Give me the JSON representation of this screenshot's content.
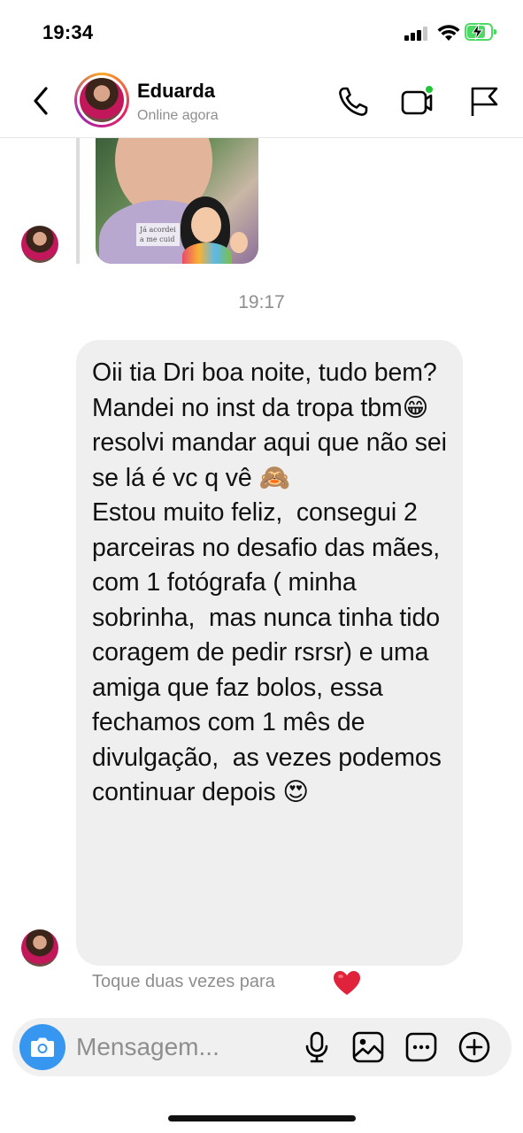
{
  "status_bar": {
    "time": "19:34"
  },
  "header": {
    "contact_name": "Eduarda",
    "contact_status": "Online agora",
    "icons": [
      "back-chevron-icon",
      "phone-icon",
      "video-camera-icon",
      "flag-icon"
    ]
  },
  "story_reply": {
    "caption": "Já acordei\na me cuid"
  },
  "timestamp": "19:17",
  "message": {
    "text": "Oii tia Dri boa noite, tudo bem?\nMandei no inst da tropa tbm😁 resolvi mandar aqui que não sei se lá é vc q vê 🙈\nEstou muito feliz,  consegui 2 parceiras no desafio das mães,  com 1 fotógrafa ( minha sobrinha,  mas nunca tinha tido coragem de pedir rsrsr) e uma amiga que faz bolos, essa fechamos com 1 mês de divulgação,  as vezes podemos continuar depois 😍"
  },
  "reaction_hint": {
    "text": "Toque duas vezes para",
    "emoji": "heart"
  },
  "composer": {
    "placeholder": "Mensagem...",
    "icons": [
      "camera-icon",
      "microphone-icon",
      "gallery-icon",
      "sticker-icon",
      "add-icon"
    ]
  },
  "colors": {
    "accent_blue": "#3797f0",
    "online_green": "#1ec735",
    "bubble_bg": "#efefef",
    "heart_red": "#e0223a"
  }
}
